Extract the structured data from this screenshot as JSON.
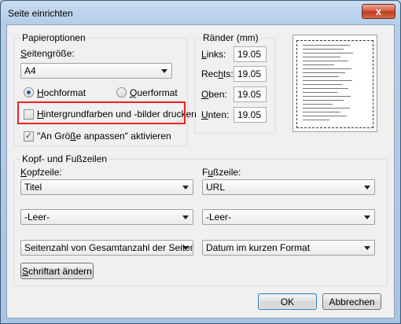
{
  "window": {
    "title": "Seite einrichten",
    "close_label": "x"
  },
  "paper": {
    "legend": "Papieroptionen",
    "size_label_pre": "",
    "size_label_u": "S",
    "size_label_post": "eitengröße:",
    "size_value": "A4",
    "portrait_u": "H",
    "portrait_rest": "ochformat",
    "portrait_selected": true,
    "landscape_u": "Q",
    "landscape_rest": "uerformat",
    "landscape_selected": false,
    "bg_u": "H",
    "bg_rest": "intergrundfarben und -bilder drucken",
    "bg_checked": false,
    "fit_pre": "\"An Grö",
    "fit_u": "ß",
    "fit_post": "e anpassen\" aktivieren",
    "fit_checked": true
  },
  "margins": {
    "legend": "Ränder (mm)",
    "left_u": "L",
    "left_rest": "inks:",
    "left_value": "19.05",
    "right_pre": "Rec",
    "right_u": "h",
    "right_post": "ts:",
    "right_value": "19.05",
    "top_u": "O",
    "top_rest": "ben:",
    "top_value": "19.05",
    "bottom_u": "U",
    "bottom_rest": "nten:",
    "bottom_value": "19.05"
  },
  "hf": {
    "legend": "Kopf- und Fußzeilen",
    "header_u": "K",
    "header_rest": "opfzeile:",
    "footer_pre": "F",
    "footer_u": "u",
    "footer_post": "ßzeile:",
    "header_values": [
      "Titel",
      "-Leer-",
      "Seitenzahl von Gesamtanzahl der Seiten"
    ],
    "footer_values": [
      "URL",
      "-Leer-",
      "Datum im kurzen Format"
    ],
    "font_u": "S",
    "font_rest": "chriftart ändern"
  },
  "buttons": {
    "ok": "OK",
    "cancel": "Abbrechen"
  }
}
